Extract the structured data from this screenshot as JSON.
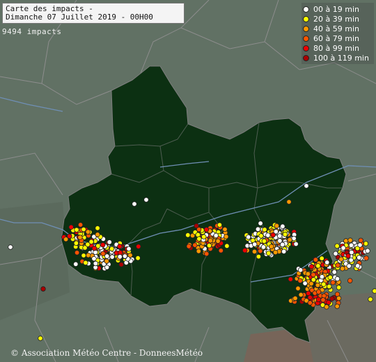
{
  "title": {
    "line1": "Carte des impacts -",
    "line2": "Dimanche 07 Juillet 2019 - 00H00"
  },
  "impacts_count": "9494 impacts",
  "legend": [
    {
      "label": "00 à 19 min",
      "color": "#ffffff"
    },
    {
      "label": "20 à 39 min",
      "color": "#ffff00"
    },
    {
      "label": "40 à 59 min",
      "color": "#ff9900"
    },
    {
      "label": "60 à 79 min",
      "color": "#ff5500"
    },
    {
      "label": "80 à 99 min",
      "color": "#ee0000"
    },
    {
      "label": "100 à 119 min",
      "color": "#aa0000"
    }
  ],
  "credit": "© Association Météo Centre - DonneesMétéo",
  "colors": {
    "background": "#5f6f62",
    "region": "#0c3012",
    "border": "#8a8a8a",
    "river": "#6f8fb5"
  }
}
